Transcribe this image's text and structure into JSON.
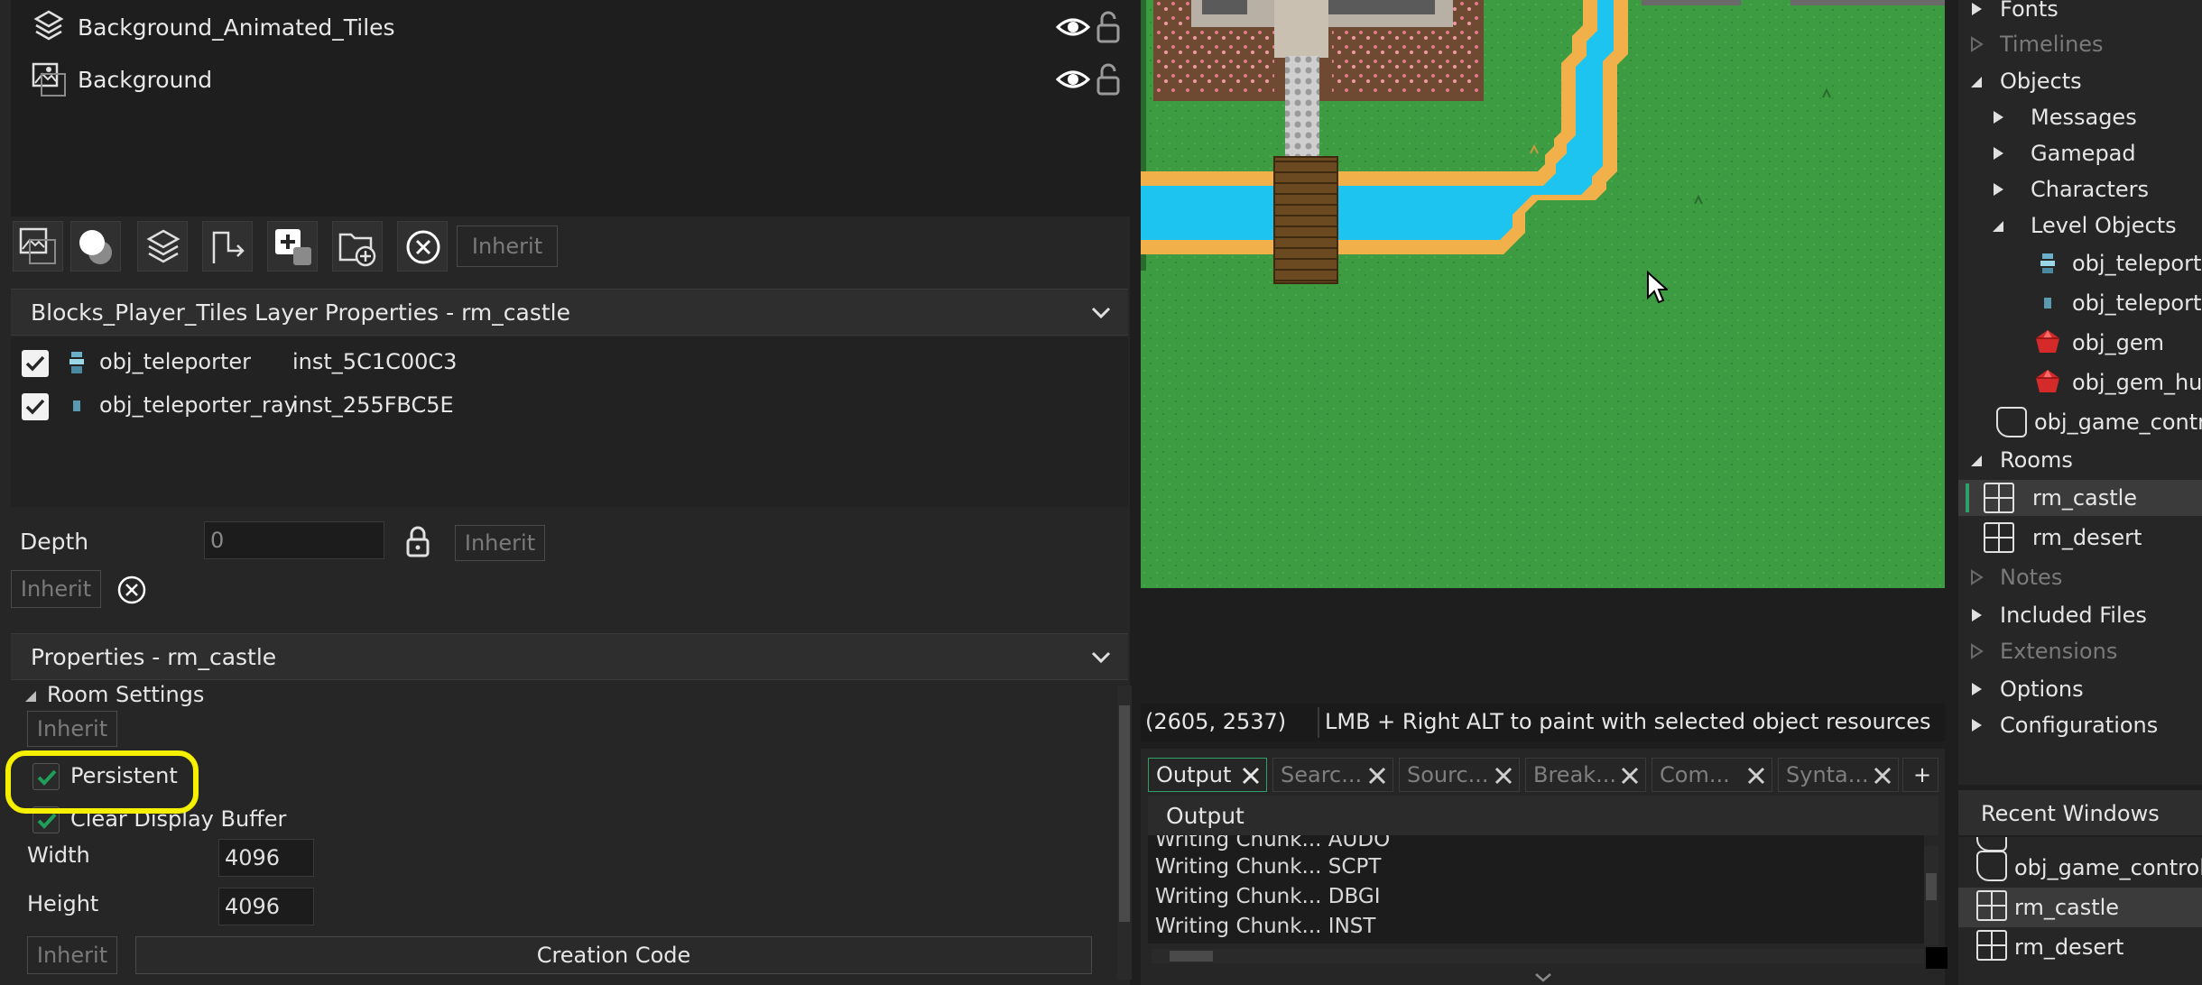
{
  "layers": [
    {
      "name": "Background_Animated_Tiles",
      "icon": "tile-layer-icon"
    },
    {
      "name": "Background",
      "icon": "background-layer-icon"
    }
  ],
  "layer_toolbar": {
    "inherit_label": "Inherit"
  },
  "layer_properties": {
    "title": "Blocks_Player_Tiles Layer Properties - rm_castle",
    "instances": [
      {
        "object": "obj_teleporter",
        "instance": "inst_5C1C00C3",
        "checked": true
      },
      {
        "object": "obj_teleporter_ray",
        "instance": "inst_255FBC5E",
        "checked": true
      }
    ],
    "depth_label": "Depth",
    "depth_value": "0",
    "inherit_label": "Inherit"
  },
  "room_properties": {
    "title": "Properties - rm_castle",
    "room_settings_label": "Room Settings",
    "inherit_label": "Inherit",
    "persistent_label": "Persistent",
    "persistent_checked": true,
    "clear_display_label": "Clear Display Buffer",
    "clear_display_checked": true,
    "width_label": "Width",
    "width_value": "4096",
    "height_label": "Height",
    "height_value": "4096",
    "creation_code_label": "Creation Code"
  },
  "status_bar": {
    "coords": "(2605, 2537)",
    "hint": "LMB + Right ALT to paint with selected object resources"
  },
  "output_panel": {
    "tabs": [
      "Output",
      "Searc...",
      "Sourc...",
      "Break...",
      "Com...",
      "Synta..."
    ],
    "add_tab": "+",
    "sub_header": "Output",
    "log_lines": [
      "Writing Chunk... AUDO",
      "Writing Chunk... SCPT",
      "Writing Chunk... DBGI",
      "Writing Chunk... INST"
    ]
  },
  "asset_tree": {
    "items": [
      {
        "label": "Fonts",
        "level": 0,
        "kind": "folder",
        "state": "collapsed",
        "dim": false
      },
      {
        "label": "Timelines",
        "level": 0,
        "kind": "folder",
        "state": "empty",
        "dim": true
      },
      {
        "label": "Objects",
        "level": 0,
        "kind": "folder",
        "state": "expanded",
        "dim": false
      },
      {
        "label": "Messages",
        "level": 1,
        "kind": "folder",
        "state": "collapsed",
        "dim": false
      },
      {
        "label": "Gamepad",
        "level": 1,
        "kind": "folder",
        "state": "collapsed",
        "dim": false
      },
      {
        "label": "Characters",
        "level": 1,
        "kind": "folder",
        "state": "collapsed",
        "dim": false
      },
      {
        "label": "Level Objects",
        "level": 1,
        "kind": "folder",
        "state": "expanded",
        "dim": false
      },
      {
        "label": "obj_teleporter",
        "level": 2,
        "kind": "sprite-teleporter",
        "state": "",
        "dim": false
      },
      {
        "label": "obj_teleporter_ray",
        "level": 2,
        "kind": "sprite-ray",
        "state": "",
        "dim": false
      },
      {
        "label": "obj_gem",
        "level": 2,
        "kind": "sprite-gem",
        "state": "",
        "dim": false
      },
      {
        "label": "obj_gem_hud",
        "level": 2,
        "kind": "sprite-gem",
        "state": "",
        "dim": false
      },
      {
        "label": "obj_game_controller",
        "level": 1,
        "kind": "object",
        "state": "",
        "dim": false
      },
      {
        "label": "Rooms",
        "level": 0,
        "kind": "folder",
        "state": "expanded",
        "dim": false
      },
      {
        "label": "rm_castle",
        "level": 1,
        "kind": "room",
        "state": "",
        "dim": false,
        "selected": true
      },
      {
        "label": "rm_desert",
        "level": 1,
        "kind": "room",
        "state": "",
        "dim": false
      },
      {
        "label": "Notes",
        "level": 0,
        "kind": "folder",
        "state": "empty",
        "dim": true
      },
      {
        "label": "Included Files",
        "level": 0,
        "kind": "folder",
        "state": "collapsed",
        "dim": false
      },
      {
        "label": "Extensions",
        "level": 0,
        "kind": "folder",
        "state": "empty",
        "dim": true
      },
      {
        "label": "Options",
        "level": 0,
        "kind": "folder",
        "state": "collapsed",
        "dim": false
      },
      {
        "label": "Configurations",
        "level": 0,
        "kind": "folder",
        "state": "collapsed",
        "dim": false
      }
    ]
  },
  "recent_windows": {
    "title": "Recent Windows",
    "items": [
      {
        "label": "obj_game_controller",
        "kind": "object",
        "selected": false
      },
      {
        "label": "rm_castle",
        "kind": "room",
        "selected": true
      },
      {
        "label": "rm_desert",
        "kind": "room",
        "selected": false
      }
    ]
  },
  "colors": {
    "grass": "#3d9c42",
    "water": "#1ec4f0",
    "sand": "#f2b04a",
    "highlight": "#f4f000",
    "checkbox_tick": "#1f9e5a"
  }
}
